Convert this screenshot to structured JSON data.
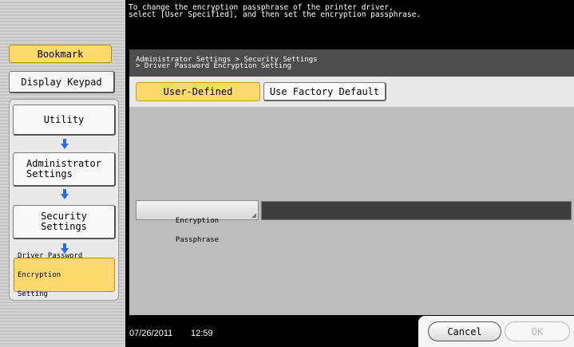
{
  "message": {
    "line1": "To change the encryption passphrase of the printer driver,",
    "line2": "select [User Specified], and then set the encryption passphrase."
  },
  "breadcrumb": {
    "line1": "Administrator Settings > Security Settings",
    "line2": "> Driver Password Encryption Setting"
  },
  "tabs": {
    "user_defined": "User-Defined",
    "factory_default": "Use Factory Default"
  },
  "encryption": {
    "label_line1": "Encryption",
    "label_line2": "Passphrase",
    "value": ""
  },
  "sidebar": {
    "bookmark": "Bookmark",
    "display_keypad": "Display Keypad",
    "utility": "Utility",
    "admin_settings_line1": "Administrator",
    "admin_settings_line2": "Settings",
    "security_settings_line1": "Security",
    "security_settings_line2": "Settings",
    "driver_pw_line1": "Driver Password",
    "driver_pw_line2": "Encryption",
    "driver_pw_line3": "Setting"
  },
  "footer": {
    "date": "07/26/2011",
    "time": "12:59",
    "cancel": "Cancel",
    "ok": "OK"
  },
  "colors": {
    "accent_yellow": "#ffd96b",
    "nav_arrow": "#2a6ee0"
  }
}
